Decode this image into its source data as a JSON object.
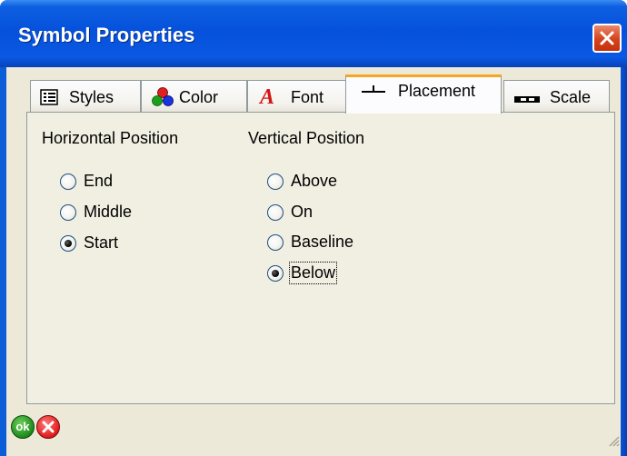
{
  "window": {
    "title": "Symbol Properties"
  },
  "tabs": [
    {
      "label": "Styles",
      "icon": "list-icon"
    },
    {
      "label": "Color",
      "icon": "color-circles-icon"
    },
    {
      "label": "Font",
      "icon": "font-a-icon"
    },
    {
      "label": "Placement",
      "icon": "placement-icon"
    },
    {
      "label": "Scale",
      "icon": "scale-icon"
    }
  ],
  "active_tab": "Placement",
  "placement": {
    "horizontal": {
      "label": "Horizontal Position",
      "options": [
        "End",
        "Middle",
        "Start"
      ],
      "selected": "Start"
    },
    "vertical": {
      "label": "Vertical Position",
      "options": [
        "Above",
        "On",
        "Baseline",
        "Below"
      ],
      "selected": "Below"
    }
  },
  "buttons": {
    "ok_label": "ok"
  },
  "colors": {
    "titlebar": "#0551dc",
    "client": "#ece9d8",
    "tab_highlight": "#f5a623"
  }
}
